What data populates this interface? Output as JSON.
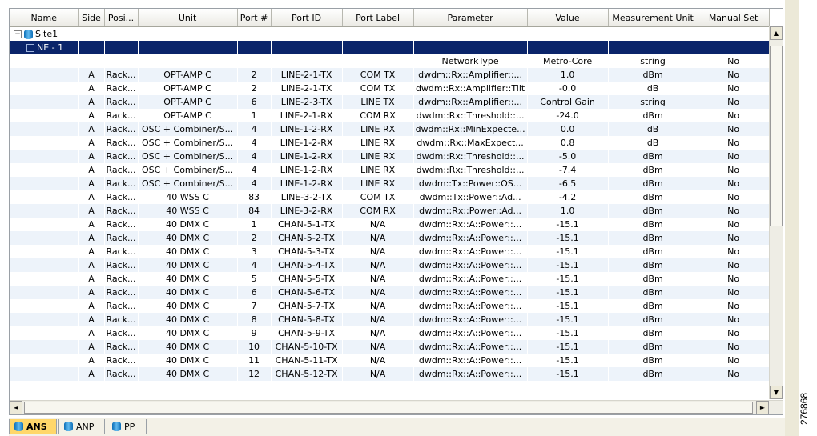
{
  "columns": [
    "Name",
    "Side",
    "Posi...",
    "Unit",
    "Port #",
    "Port ID",
    "Port Label",
    "Parameter",
    "Value",
    "Measurement Unit",
    "Manual Set"
  ],
  "tree": {
    "site": "Site1",
    "ne": "NE - 1"
  },
  "network_row": {
    "parameter": "NetworkType",
    "value": "Metro-Core",
    "unit": "string",
    "manual": "No"
  },
  "rows": [
    [
      "A",
      "Rack...",
      "OPT-AMP C",
      "2",
      "LINE-2-1-TX",
      "COM TX",
      "dwdm::Rx::Amplifier::...",
      "1.0",
      "dBm",
      "No"
    ],
    [
      "A",
      "Rack...",
      "OPT-AMP C",
      "2",
      "LINE-2-1-TX",
      "COM TX",
      "dwdm::Rx::Amplifier::Tilt",
      "-0.0",
      "dB",
      "No"
    ],
    [
      "A",
      "Rack...",
      "OPT-AMP C",
      "6",
      "LINE-2-3-TX",
      "LINE TX",
      "dwdm::Rx::Amplifier::...",
      "Control Gain",
      "string",
      "No"
    ],
    [
      "A",
      "Rack...",
      "OPT-AMP C",
      "1",
      "LINE-2-1-RX",
      "COM RX",
      "dwdm::Rx::Threshold::...",
      "-24.0",
      "dBm",
      "No"
    ],
    [
      "A",
      "Rack...",
      "OSC + Combiner/S...",
      "4",
      "LINE-1-2-RX",
      "LINE RX",
      "dwdm::Rx::MinExpecte...",
      "0.0",
      "dB",
      "No"
    ],
    [
      "A",
      "Rack...",
      "OSC + Combiner/S...",
      "4",
      "LINE-1-2-RX",
      "LINE RX",
      "dwdm::Rx::MaxExpect...",
      "0.8",
      "dB",
      "No"
    ],
    [
      "A",
      "Rack...",
      "OSC + Combiner/S...",
      "4",
      "LINE-1-2-RX",
      "LINE RX",
      "dwdm::Rx::Threshold::...",
      "-5.0",
      "dBm",
      "No"
    ],
    [
      "A",
      "Rack...",
      "OSC + Combiner/S...",
      "4",
      "LINE-1-2-RX",
      "LINE RX",
      "dwdm::Rx::Threshold::...",
      "-7.4",
      "dBm",
      "No"
    ],
    [
      "A",
      "Rack...",
      "OSC + Combiner/S...",
      "4",
      "LINE-1-2-RX",
      "LINE RX",
      "dwdm::Tx::Power::OS...",
      "-6.5",
      "dBm",
      "No"
    ],
    [
      "A",
      "Rack...",
      "40 WSS C",
      "83",
      "LINE-3-2-TX",
      "COM TX",
      "dwdm::Tx::Power::Ad...",
      "-4.2",
      "dBm",
      "No"
    ],
    [
      "A",
      "Rack...",
      "40 WSS C",
      "84",
      "LINE-3-2-RX",
      "COM RX",
      "dwdm::Rx::Power::Ad...",
      "1.0",
      "dBm",
      "No"
    ],
    [
      "A",
      "Rack...",
      "40 DMX C",
      "1",
      "CHAN-5-1-TX",
      "N/A",
      "dwdm::Rx::A::Power::...",
      "-15.1",
      "dBm",
      "No"
    ],
    [
      "A",
      "Rack...",
      "40 DMX C",
      "2",
      "CHAN-5-2-TX",
      "N/A",
      "dwdm::Rx::A::Power::...",
      "-15.1",
      "dBm",
      "No"
    ],
    [
      "A",
      "Rack...",
      "40 DMX C",
      "3",
      "CHAN-5-3-TX",
      "N/A",
      "dwdm::Rx::A::Power::...",
      "-15.1",
      "dBm",
      "No"
    ],
    [
      "A",
      "Rack...",
      "40 DMX C",
      "4",
      "CHAN-5-4-TX",
      "N/A",
      "dwdm::Rx::A::Power::...",
      "-15.1",
      "dBm",
      "No"
    ],
    [
      "A",
      "Rack...",
      "40 DMX C",
      "5",
      "CHAN-5-5-TX",
      "N/A",
      "dwdm::Rx::A::Power::...",
      "-15.1",
      "dBm",
      "No"
    ],
    [
      "A",
      "Rack...",
      "40 DMX C",
      "6",
      "CHAN-5-6-TX",
      "N/A",
      "dwdm::Rx::A::Power::...",
      "-15.1",
      "dBm",
      "No"
    ],
    [
      "A",
      "Rack...",
      "40 DMX C",
      "7",
      "CHAN-5-7-TX",
      "N/A",
      "dwdm::Rx::A::Power::...",
      "-15.1",
      "dBm",
      "No"
    ],
    [
      "A",
      "Rack...",
      "40 DMX C",
      "8",
      "CHAN-5-8-TX",
      "N/A",
      "dwdm::Rx::A::Power::...",
      "-15.1",
      "dBm",
      "No"
    ],
    [
      "A",
      "Rack...",
      "40 DMX C",
      "9",
      "CHAN-5-9-TX",
      "N/A",
      "dwdm::Rx::A::Power::...",
      "-15.1",
      "dBm",
      "No"
    ],
    [
      "A",
      "Rack...",
      "40 DMX C",
      "10",
      "CHAN-5-10-TX",
      "N/A",
      "dwdm::Rx::A::Power::...",
      "-15.1",
      "dBm",
      "No"
    ],
    [
      "A",
      "Rack...",
      "40 DMX C",
      "11",
      "CHAN-5-11-TX",
      "N/A",
      "dwdm::Rx::A::Power::...",
      "-15.1",
      "dBm",
      "No"
    ],
    [
      "A",
      "Rack...",
      "40 DMX C",
      "12",
      "CHAN-5-12-TX",
      "N/A",
      "dwdm::Rx::A::Power::...",
      "-15.1",
      "dBm",
      "No"
    ]
  ],
  "tabs": [
    "ANS",
    "ANP",
    "PP"
  ],
  "figure_number": "276868",
  "icons": {
    "expander": "minus-expander-icon",
    "site": "site-cylinder-icon",
    "tab": "cylinder-icon"
  },
  "colors": {
    "selection": "#0a246a",
    "alt_row": "#edf3fa",
    "active_tab": "#ffd76a"
  }
}
